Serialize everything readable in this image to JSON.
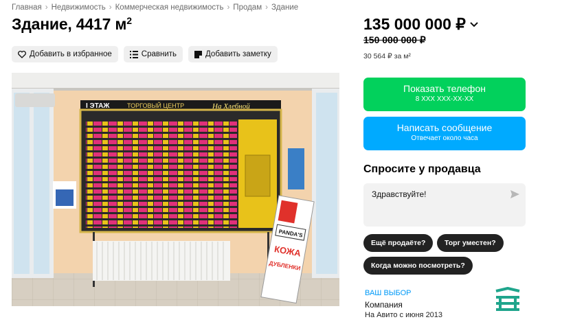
{
  "breadcrumbs": [
    "Главная",
    "Недвижимость",
    "Коммерческая недвижимость",
    "Продам",
    "Здание"
  ],
  "breadcrumb_separator": "›",
  "title": {
    "text": "Здание, 4417 м",
    "sup": "2"
  },
  "actions": [
    {
      "label": "Добавить в избранное",
      "icon": "heart-icon"
    },
    {
      "label": "Сравнить",
      "icon": "compare-icon"
    },
    {
      "label": "Добавить заметку",
      "icon": "note-icon"
    }
  ],
  "photo": {
    "sign_header_left": "I ЭТАЖ",
    "sign_header_mid": "ТОРГОВЫЙ ЦЕНТР",
    "sign_header_right": "На Хлебной",
    "stand_board_brand": "PANDA'S",
    "stand_board_line1": "КОЖА",
    "stand_board_line2": "ДУБЛЕНКИ"
  },
  "price": {
    "current": "135 000 000 ₽",
    "old": "150 000 000 ₽",
    "per_meter": "30 564 ₽ за м²"
  },
  "phone_button": {
    "label": "Показать телефон",
    "sub": "8 XXX XXX-XX-XX",
    "color": "#02d15c"
  },
  "message_button": {
    "label": "Написать сообщение",
    "sub": "Отвечает около часа",
    "color": "#00aaff"
  },
  "ask_seller": {
    "title": "Спросите у продавца",
    "message": "Здравствуйте!",
    "chips": [
      "Ещё продаёте?",
      "Торг уместен?",
      "Когда можно посмотреть?"
    ]
  },
  "seller": {
    "name": "ВАШ ВЫБОР",
    "type": "Компания",
    "since": "На Авито с июня 2013",
    "logo_icon": "company-logo-icon"
  }
}
